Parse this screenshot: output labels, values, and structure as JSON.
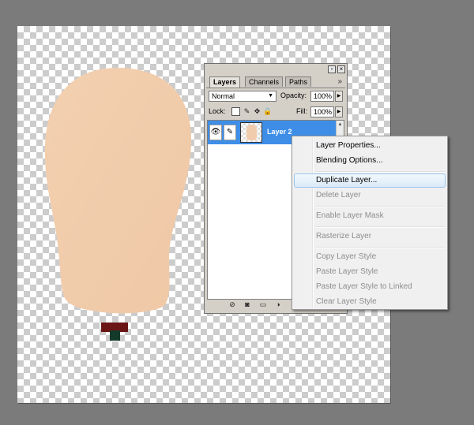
{
  "canvas": {
    "shape_fill": "#f0ccac",
    "stem_color": "#6b1616",
    "post_color": "#143a2a"
  },
  "layers_panel": {
    "tabs": [
      "Layers",
      "Channels",
      "Paths"
    ],
    "active_tab": "Layers",
    "blend_mode": "Normal",
    "opacity_label": "Opacity:",
    "opacity_value": "100%",
    "lock_label": "Lock:",
    "fill_label": "Fill:",
    "fill_value": "100%",
    "layers": [
      {
        "name": "Layer 2",
        "selected": true
      }
    ],
    "selection_color": "#3e8ee8"
  },
  "context_menu": {
    "items": [
      {
        "label": "Layer Properties...",
        "enabled": true
      },
      {
        "label": "Blending Options...",
        "enabled": true
      },
      {
        "label": "Duplicate Layer...",
        "enabled": true,
        "highlighted": true
      },
      {
        "label": "Delete Layer",
        "enabled": false
      },
      {
        "label": "Enable Layer Mask",
        "enabled": false
      },
      {
        "label": "Rasterize Layer",
        "enabled": false
      },
      {
        "label": "Copy Layer Style",
        "enabled": false
      },
      {
        "label": "Paste Layer Style",
        "enabled": false
      },
      {
        "label": "Paste Layer Style to Linked",
        "enabled": false
      },
      {
        "label": "Clear Layer Style",
        "enabled": false
      }
    ]
  }
}
